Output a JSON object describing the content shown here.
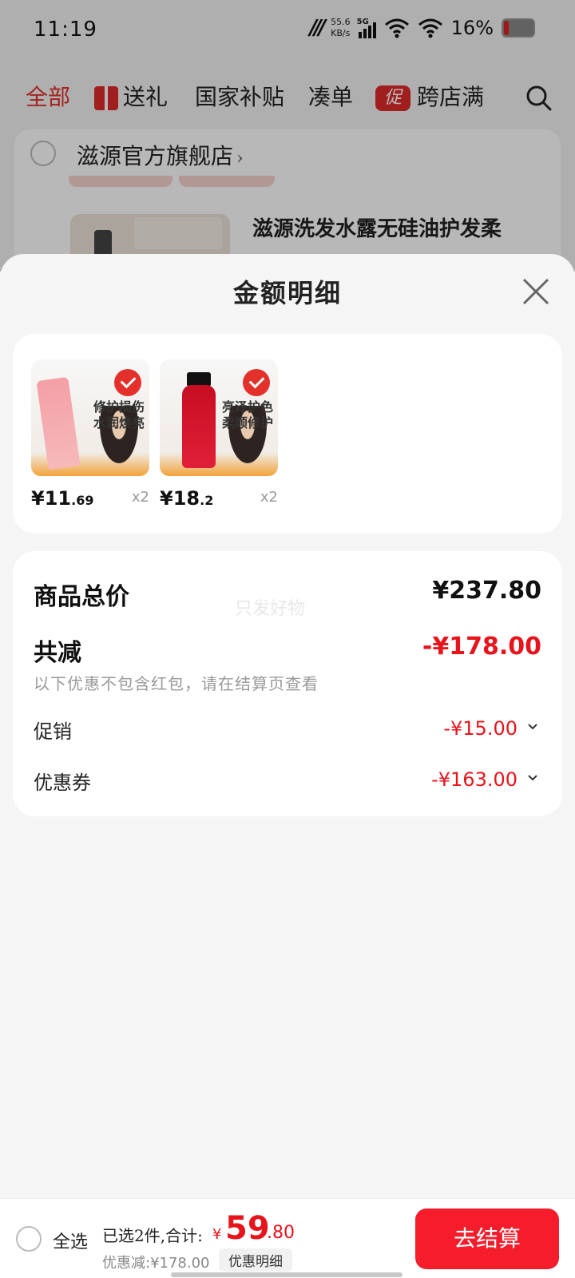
{
  "status_bar": {
    "time": "11:19",
    "net_speed_value": "55.6",
    "net_speed_unit": "KB/s",
    "network_type": "5G",
    "battery_percent": "16%"
  },
  "top_tabs": [
    {
      "label": "全部",
      "active": true
    },
    {
      "label": "送礼",
      "icon": "gift-icon"
    },
    {
      "label": "国家补贴"
    },
    {
      "label": "凑单"
    },
    {
      "label": "跨店满",
      "icon_text": "促"
    }
  ],
  "store": {
    "name": "滋源官方旗舰店",
    "product_title": "滋源洗发水露无硅油护发柔"
  },
  "sheet": {
    "title": "金额明细",
    "items": [
      {
        "price_int": "¥11",
        "price_dec": ".69",
        "qty": "x2",
        "tagline": "修护损伤 水润焕亮",
        "checked": true
      },
      {
        "price_int": "¥18",
        "price_dec": ".2",
        "qty": "x2",
        "tagline": "亮泽护色 柔顺修护",
        "checked": true
      }
    ],
    "summary": {
      "total_label": "商品总价",
      "total_value": "¥237.80",
      "watermark": "只发好物",
      "reduce_label": "共减",
      "reduce_value": "-¥178.00",
      "reduce_note": "以下优惠不包含红包，请在结算页查看",
      "promo_label": "促销",
      "promo_value": "-¥15.00",
      "coupon_label": "优惠券",
      "coupon_value": "-¥163.00"
    }
  },
  "bottom_bar": {
    "select_all": "全选",
    "selected_text": "已选2件,合计:",
    "currency": "¥",
    "total_int": "59",
    "total_dec": ".80",
    "discount_text": "优惠减:¥178.00",
    "detail_button": "优惠明细",
    "checkout_button": "去结算"
  },
  "colors": {
    "accent_red": "#e8141c",
    "button_red": "#f51d2c",
    "background": "#f5f5f5"
  }
}
